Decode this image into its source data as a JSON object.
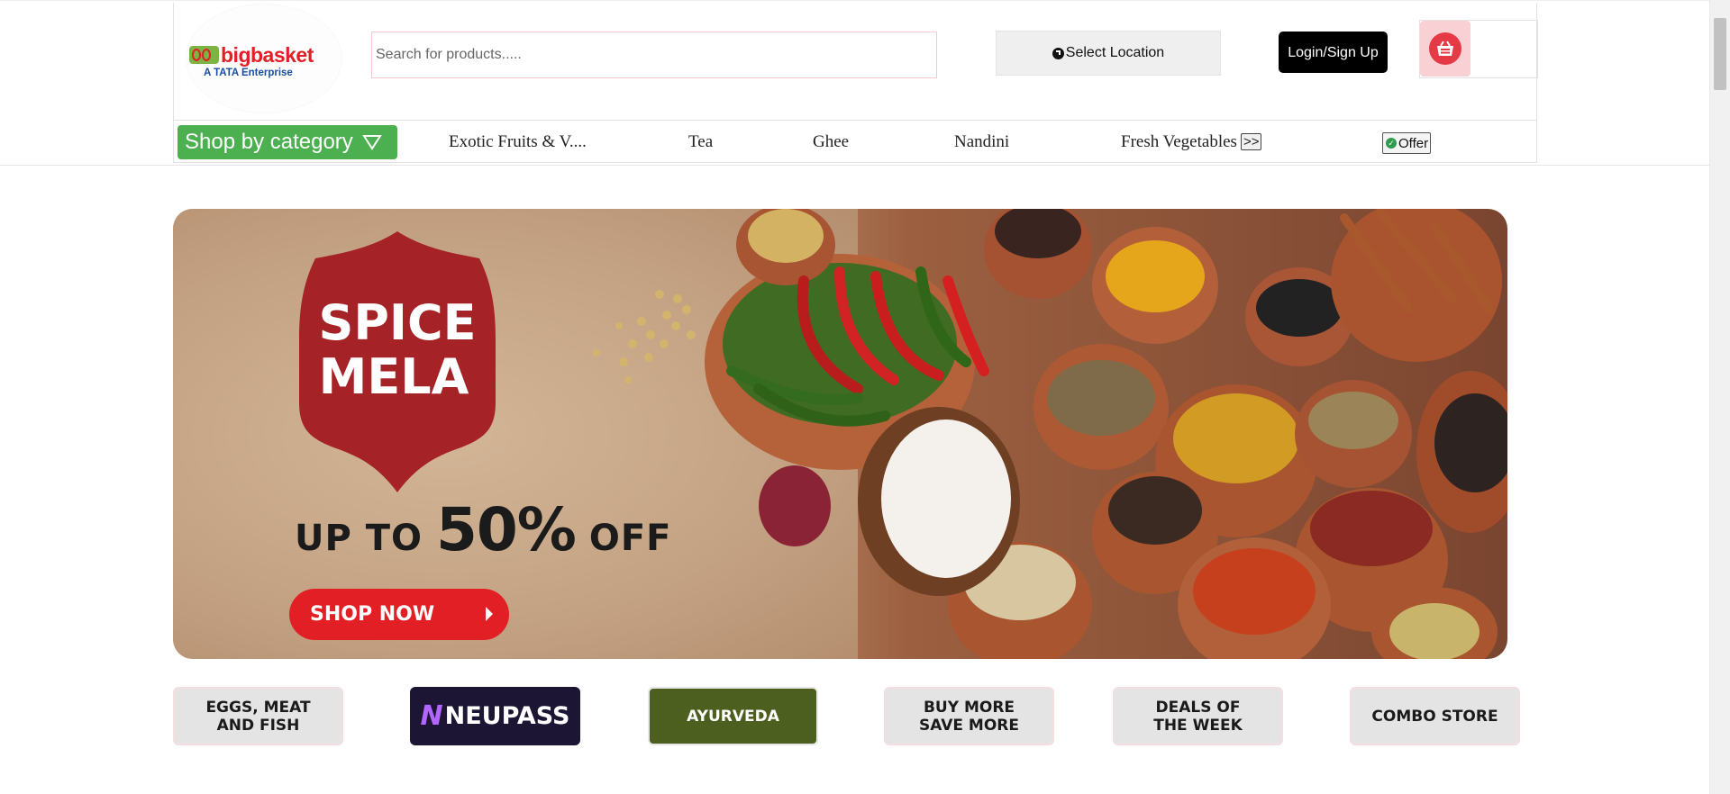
{
  "header": {
    "logo_text": "bigbasket",
    "logo_sub": "A TATA Enterprise",
    "search_placeholder": "Search for products.....",
    "location_label": "Select Location",
    "login_label": "Login/Sign Up",
    "cart_icon": "cart-icon"
  },
  "nav": {
    "category_label": "Shop by category",
    "links": [
      "Exotic Fruits & V....",
      "Tea",
      "Ghee",
      "Nandini",
      "Fresh Vegetables"
    ],
    "more_label": ">>",
    "offer_label": "Offer"
  },
  "banner": {
    "seal_line1": "SPICE",
    "seal_line2": "MELA",
    "offer_prefix": "UP TO ",
    "offer_value": "50%",
    "offer_suffix": " OFF",
    "cta_label": "SHOP NOW"
  },
  "tiles": [
    {
      "label": "EGGS, MEAT AND FISH"
    },
    {
      "label": "NEUPASS"
    },
    {
      "label": "AYURVEDA"
    },
    {
      "label": "BUY MORE SAVE MORE"
    },
    {
      "label": "DEALS OF THE WEEK"
    },
    {
      "label": "COMBO STORE"
    }
  ],
  "colors": {
    "category_button": "#4caf50",
    "cta": "#e31f26",
    "cart_accent": "#e53945",
    "ayurveda_tile": "#4d5f1f",
    "neupass_tile": "#1c1533"
  }
}
